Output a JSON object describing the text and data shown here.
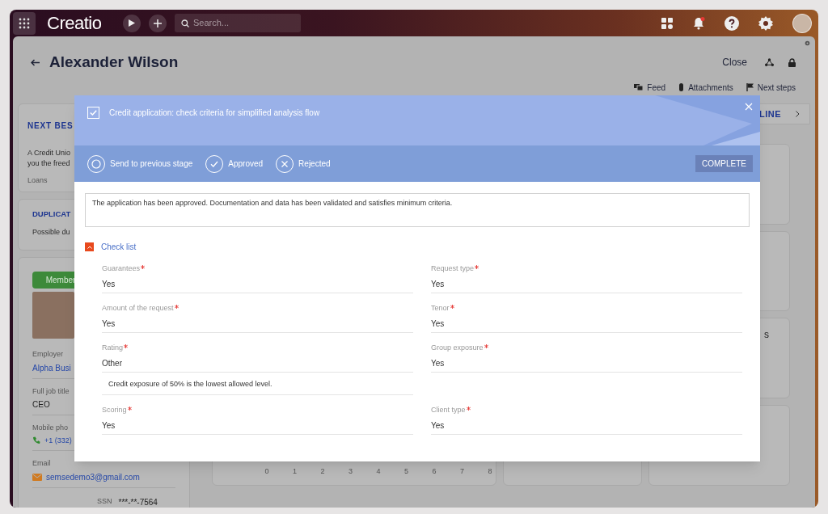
{
  "app_bar": {
    "logo": "Creatio",
    "search": {
      "placeholder": "Search..."
    },
    "has_notification": true
  },
  "record": {
    "title": "Alexander Wilson",
    "close": "Close",
    "tabs": [
      "Feed",
      "Attachments",
      "Next steps"
    ]
  },
  "left_panel": {
    "next_best": {
      "title": "NEXT BES",
      "lines": [
        "A Credit Unio",
        "you the freed"
      ],
      "tag": "Loans"
    },
    "duplicates": {
      "title": "DUPLICAT",
      "text": "Possible du"
    },
    "profile": {
      "badge": "Member",
      "fields": [
        {
          "label": "Employer",
          "value": "Alpha Busi",
          "kind": "link"
        },
        {
          "label": "Full job title",
          "value": "CEO",
          "kind": "text"
        },
        {
          "label": "Mobile pho",
          "value": "+1 (332)",
          "kind": "phone"
        },
        {
          "label": "Email",
          "value": "semsedemo3@gmail.com",
          "kind": "email"
        }
      ],
      "ssn_label": "SSN",
      "ssn": "***-**-7564"
    }
  },
  "timeline": {
    "title": "LINE"
  },
  "chart_ticks": [
    "0",
    "1",
    "2",
    "3",
    "4",
    "5",
    "6",
    "7",
    "8"
  ],
  "right_card_title": "s",
  "modal": {
    "title": "Credit application: check criteria for simplified analysis flow",
    "checked": true,
    "outcomes": [
      {
        "label": "Send to previous stage",
        "kind": "previous"
      },
      {
        "label": "Approved",
        "kind": "approve"
      },
      {
        "label": "Rejected",
        "kind": "reject"
      }
    ],
    "complete": "COMPLETE",
    "comment": "The application has been approved. Documentation and data has been validated and satisfies minimum criteria.",
    "checklist": {
      "title": "Check list",
      "expanded": true,
      "rows": [
        [
          {
            "label": "Guarantees",
            "required": true,
            "value": "Yes"
          },
          {
            "label": "Request type",
            "required": true,
            "value": "Yes"
          }
        ],
        [
          {
            "label": "Amount of the request",
            "required": true,
            "value": "Yes"
          },
          {
            "label": "Tenor",
            "required": true,
            "value": "Yes"
          }
        ],
        [
          {
            "label": "Rating",
            "required": true,
            "value": "Other",
            "note": "Credit exposure of 50% is the lowest allowed level."
          },
          {
            "label": "Group exposure",
            "required": true,
            "value": "Yes"
          }
        ],
        [
          {
            "label": "Scoring",
            "required": true,
            "value": "Yes"
          },
          {
            "label": "Client type",
            "required": true,
            "value": "Yes"
          }
        ]
      ]
    }
  }
}
